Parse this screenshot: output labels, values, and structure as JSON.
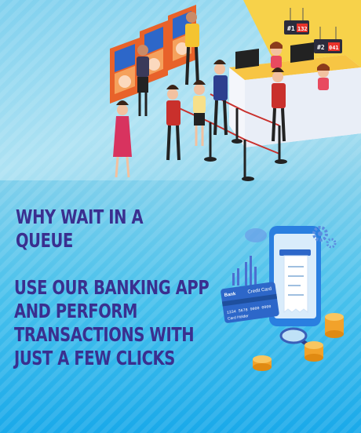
{
  "headline": "WHY WAIT IN A QUEUE",
  "body_text": "USE OUR BANKING APP\nAND PERFORM\nTRANSACTIONS WITH\nJUST A FEW CLICKS",
  "counter_signs": [
    {
      "desk": "#1",
      "number": "132"
    },
    {
      "desk": "#2",
      "number": "041"
    }
  ],
  "card": {
    "brand": "Bank",
    "type": "Credit Card",
    "number": "1234  5678  9000  0000",
    "holder": "Card Holder"
  },
  "colors": {
    "text": "#3a2f8f",
    "wall": "#f7d24a",
    "accent_orange": "#e8622a",
    "accent_blue": "#2d67c9"
  }
}
